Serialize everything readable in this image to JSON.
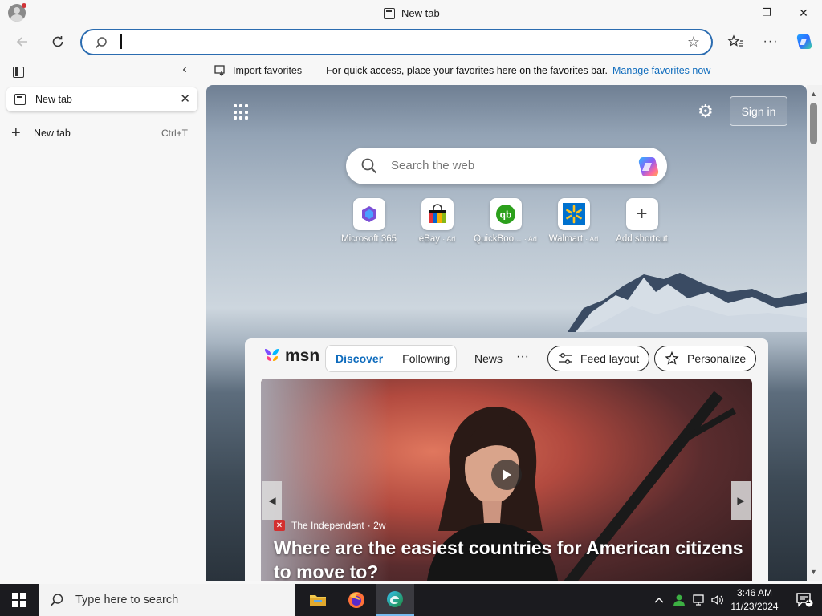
{
  "window": {
    "title": "New tab",
    "minimize": "—",
    "maximize": "❐",
    "close": "✕"
  },
  "address_bar": {
    "value": "",
    "placeholder": ""
  },
  "favorites_bar": {
    "import_label": "Import favorites",
    "message": "For quick access, place your favorites here on the favorites bar.",
    "manage_link": "Manage favorites now"
  },
  "sidebar": {
    "tabs": [
      {
        "label": "New tab"
      }
    ],
    "new_tab_label": "New tab",
    "new_tab_shortcut": "Ctrl+T"
  },
  "newtab_page": {
    "sign_in": "Sign in",
    "search_placeholder": "Search the web",
    "shortcuts": [
      {
        "name": "Microsoft 365",
        "ad": ""
      },
      {
        "name": "eBay",
        "ad": "· Ad"
      },
      {
        "name": "QuickBoo...",
        "ad": "· Ad"
      },
      {
        "name": "Walmart",
        "ad": "· Ad"
      },
      {
        "name": "Add shortcut",
        "ad": ""
      }
    ]
  },
  "feed": {
    "logo": "msn",
    "tabs": [
      "Discover",
      "Following"
    ],
    "news": "News",
    "more": "···",
    "feed_layout": "Feed layout",
    "personalize": "Personalize",
    "hero": {
      "source": "The Independent",
      "age": "· 2w",
      "headline": "Where are the easiest countries for American citizens to move to?"
    }
  },
  "taskbar": {
    "search_label": "Type here to search",
    "time": "3:46 AM",
    "date": "11/23/2024",
    "notification_count": "1"
  },
  "colors": {
    "accent": "#0f6cbd",
    "address_border": "#2b6cb0",
    "taskbar": "#1b1b1f"
  }
}
